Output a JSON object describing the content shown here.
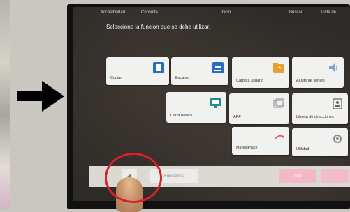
{
  "topbar": {
    "left_1": "Accesibilidad",
    "left_2": "Consulta",
    "center": "Inicio",
    "search": "Buscar",
    "right": "Lista de"
  },
  "instruction": "Seleccione la funcion que se debe utilizar.",
  "tiles": [
    {
      "label": "Copiar",
      "icon": "copy-icon"
    },
    {
      "label": "Escaner",
      "icon": "scanner-icon"
    },
    {
      "label": "Carpeta usuario",
      "icon": "folder-icon"
    },
    {
      "label": "Ajuste de sonido",
      "icon": "speaker-icon"
    },
    {
      "label": "Carta basica",
      "icon": "screen-icon"
    },
    {
      "label": "APP",
      "icon": "app-icon"
    },
    {
      "label": "Libreta de direcciones",
      "icon": "address-book-icon"
    },
    {
      "label": "MarketPlace",
      "icon": "marketplace-icon"
    },
    {
      "label": "Utilidad",
      "icon": "utility-icon"
    }
  ],
  "bottombar": {
    "function_label": "Funciones",
    "start_label": "Inicio"
  },
  "colors": {
    "accent_red": "#d8222a",
    "start_pink": "#f3b9c8"
  }
}
